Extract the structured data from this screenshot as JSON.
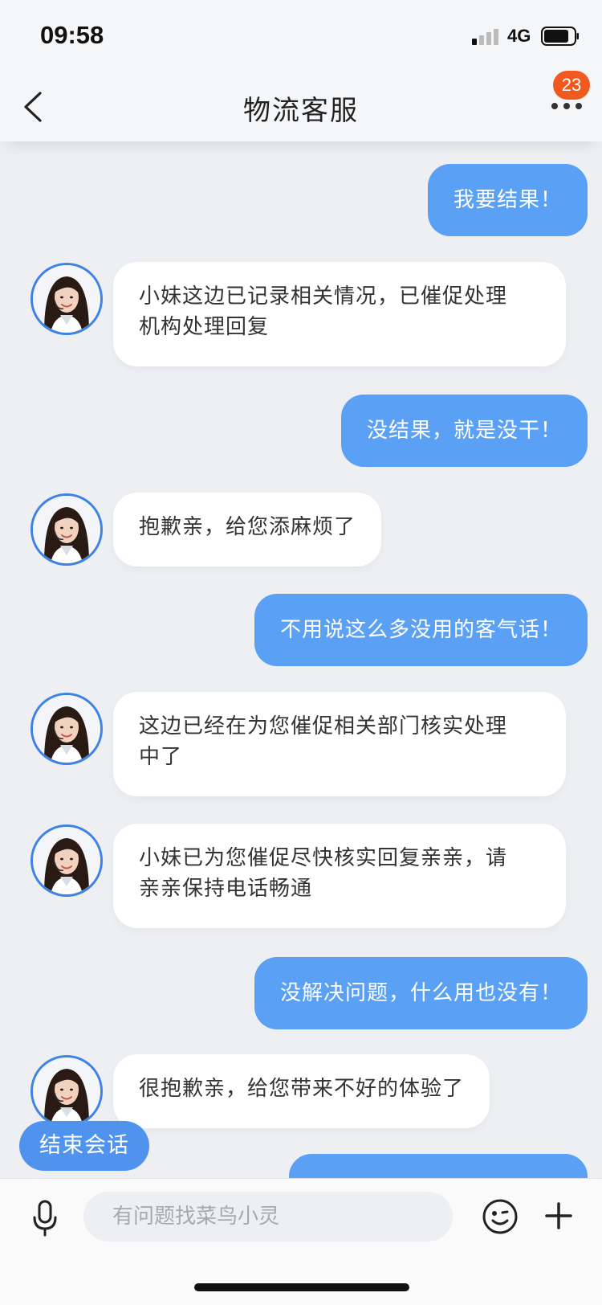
{
  "status_bar": {
    "time": "09:58",
    "network": "4G",
    "icons": [
      "signal-icon",
      "battery-icon"
    ]
  },
  "header": {
    "title": "物流客服",
    "back_icon": "chevron-left-icon",
    "more_icon": "more-dots-icon",
    "badge_count": "23",
    "badge_color": "#f05a1f"
  },
  "messages": [
    {
      "sender": "user",
      "text": "我要结果！"
    },
    {
      "sender": "agent",
      "lines": [
        "小妹这边已记录相关情况，已催促处理",
        "机构处理回复"
      ]
    },
    {
      "sender": "user",
      "text": "没结果，就是没干！"
    },
    {
      "sender": "agent",
      "lines": [
        "抱歉亲，给您添麻烦了"
      ]
    },
    {
      "sender": "user",
      "text": "不用说这么多没用的客气话！"
    },
    {
      "sender": "agent",
      "lines": [
        "这边已经在为您催促相关部门核实处理",
        "中了"
      ]
    },
    {
      "sender": "agent",
      "lines": [
        "小妹已为您催促尽快核实回复亲亲，请",
        "亲亲保持电话畅通"
      ]
    },
    {
      "sender": "user",
      "text": "没解决问题，什么用也没有！"
    },
    {
      "sender": "agent",
      "lines": [
        "很抱歉亲，给您带来不好的体验了"
      ]
    }
  ],
  "end_session_label": "结束会话",
  "input_bar": {
    "placeholder": "有问题找菜鸟小灵",
    "icons": [
      "microphone-icon",
      "emoji-icon",
      "plus-icon"
    ]
  },
  "colors": {
    "user_bubble": "#5aa0f5",
    "agent_bubble": "#ffffff",
    "background": "#edeff3",
    "avatar_ring": "#3d82e6"
  }
}
